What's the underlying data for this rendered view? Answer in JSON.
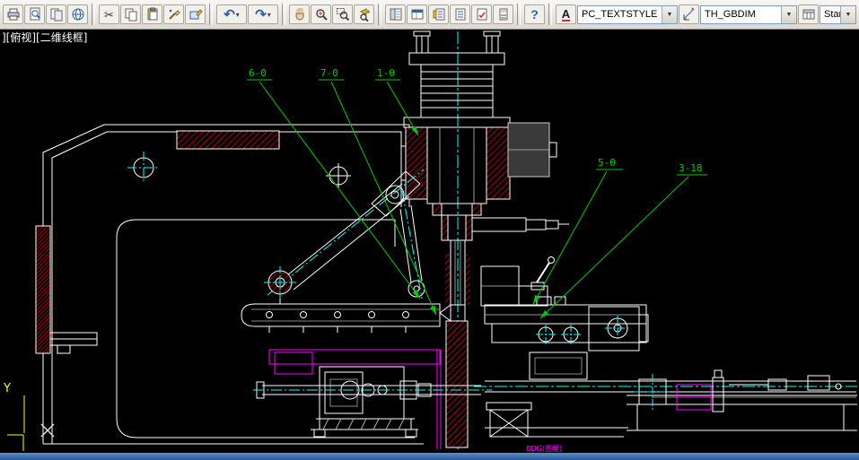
{
  "toolbar": {
    "combos": {
      "text_style": "PC_TEXTSTYLE",
      "dim_style": "TH_GBDIM",
      "table_style": "Standard"
    },
    "glyphs": {
      "cut": "✂",
      "undo": "↶",
      "redo": "↷",
      "help": "?",
      "text_style_icon": "A",
      "caret": "▾",
      "combo_arrow": "▼"
    },
    "icons": [
      "plot-printer-icon",
      "plot-preview-icon",
      "publish-sheets-icon",
      "dwf-globe-icon",
      "cut-scissors-icon",
      "copy-icon",
      "paste-clipboard-icon",
      "match-properties-brush-icon",
      "block-editor-icon",
      "undo-arrow-icon",
      "redo-arrow-icon",
      "pan-hand-icon",
      "zoom-realtime-icon",
      "zoom-window-icon",
      "zoom-previous-icon",
      "properties-panel-icon",
      "designcenter-icon",
      "tool-palettes-icon",
      "sheet-set-manager-icon",
      "markup-set-manager-icon",
      "quickcalc-icon",
      "help-icon",
      "text-style-manager-icon",
      "dim-style-manager-icon",
      "table-style-manager-icon"
    ]
  },
  "canvas": {
    "viewport_label": "][俯视][二维线框]",
    "leaders": [
      {
        "text": "6-0"
      },
      {
        "text": "7-0"
      },
      {
        "text": "1-0"
      },
      {
        "text": "5-0"
      },
      {
        "text": "3-18"
      }
    ],
    "ucs": {
      "y_label": "Y"
    },
    "stamp": "BDG(图框)"
  },
  "colors": {
    "outline": "#ffffff",
    "hatch_red": "#e00000",
    "centerline_cyan": "#00ffff",
    "leader_green": "#00cc00",
    "aux_magenta": "#ff00ff",
    "ucs_yellow": "#ffff00",
    "statusbar_blue": "#2e63a6"
  }
}
